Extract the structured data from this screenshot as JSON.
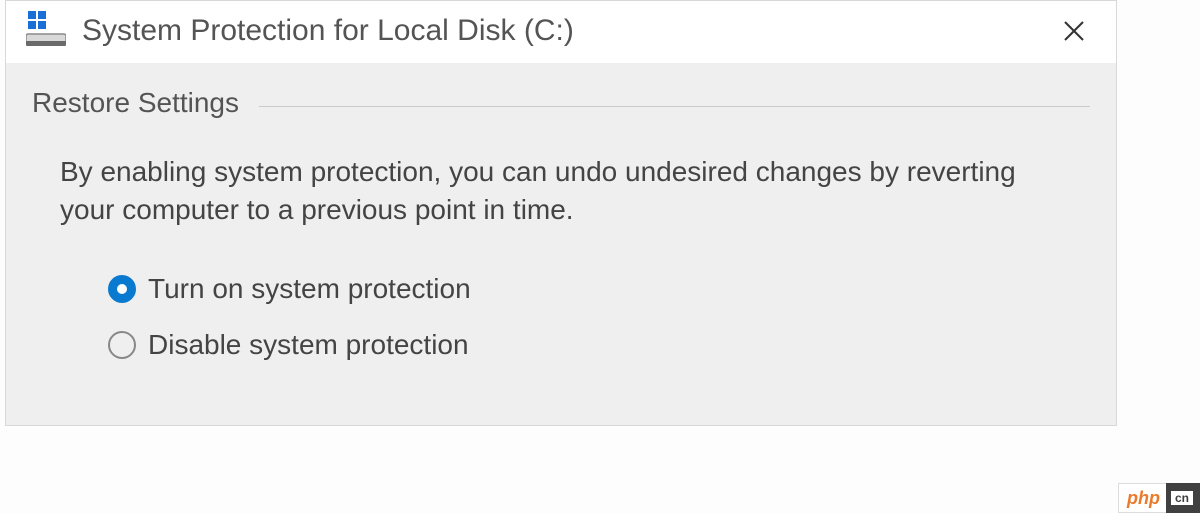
{
  "dialog": {
    "title": "System Protection for Local Disk (C:)"
  },
  "section": {
    "title": "Restore Settings",
    "description": "By enabling system protection, you can undo undesired changes by reverting your computer to a previous point in time."
  },
  "radios": {
    "turn_on": {
      "label": "Turn on system protection",
      "selected": true
    },
    "disable": {
      "label": "Disable system protection",
      "selected": false
    }
  },
  "watermark": {
    "left": "php",
    "right": "cn"
  }
}
